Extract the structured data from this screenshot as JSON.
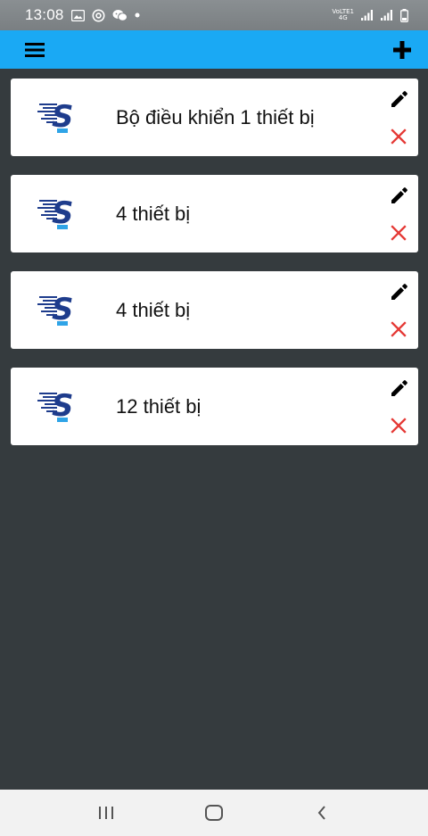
{
  "status_bar": {
    "time": "13:08",
    "left_icons": [
      "image-icon",
      "at-icon",
      "chat-icon",
      "dot-icon"
    ],
    "network_top": "VoLTE1",
    "network_bottom": "4G",
    "right_icons": [
      "signal-icon",
      "signal-icon",
      "battery-icon"
    ]
  },
  "app_bar": {
    "color": "#1aa9f4",
    "menu_icon": "hamburger-menu-icon",
    "add_icon": "plus-icon"
  },
  "devices": [
    {
      "name": "Bộ điều khiển 1 thiết bị"
    },
    {
      "name": "4 thiết bị"
    },
    {
      "name": "4 thiết bị"
    },
    {
      "name": "12 thiết bị"
    }
  ],
  "card_icons": {
    "logo": "brand-s-logo",
    "edit": "pencil-icon",
    "delete": "close-icon",
    "delete_color": "#e53935"
  },
  "nav_bar": {
    "recent": "recent-apps-icon",
    "home": "home-icon",
    "back": "back-icon"
  },
  "colors": {
    "background": "#353b3e",
    "card": "#ffffff",
    "logo_blue": "#1e3c8c",
    "logo_light": "#2fa4e7"
  }
}
